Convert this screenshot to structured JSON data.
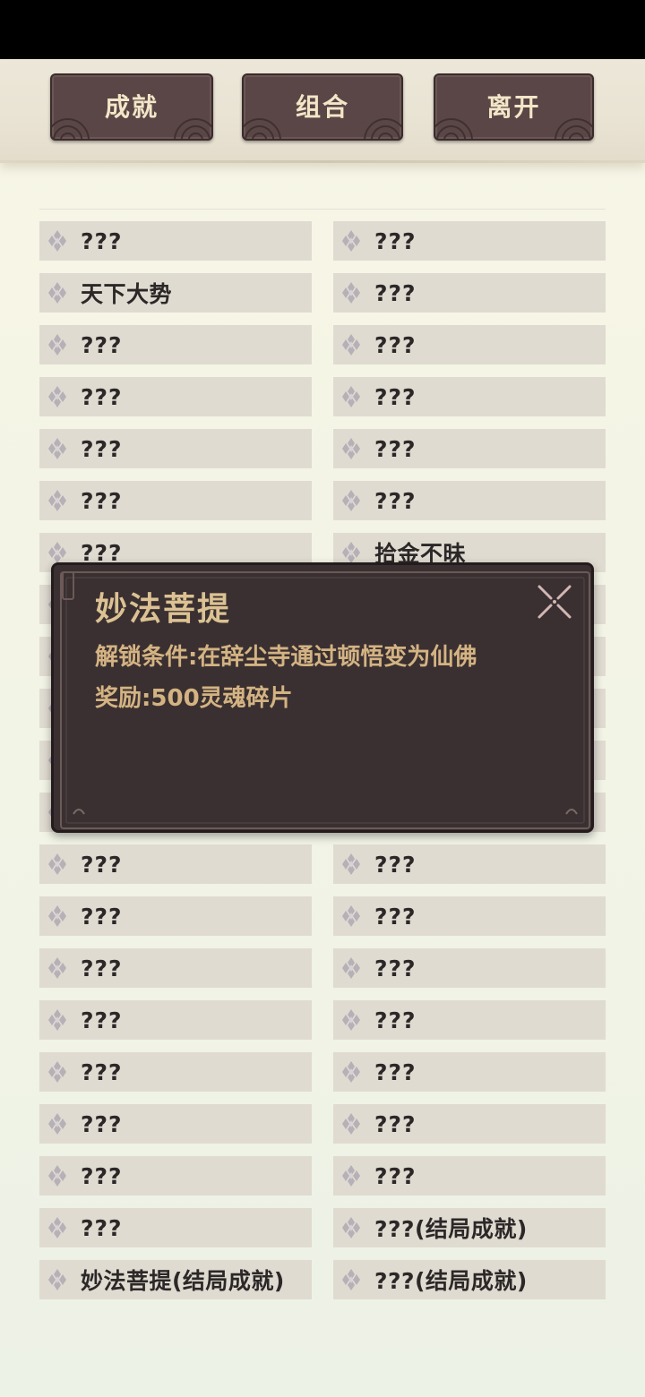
{
  "tabs": {
    "achievement": "成就",
    "combo": "组合",
    "leave": "离开"
  },
  "list": {
    "left": [
      "???",
      "天下大势",
      "???",
      "???",
      "???",
      "???",
      "???",
      "???",
      "???",
      "???",
      "???",
      "???",
      "???",
      "???",
      "???",
      "???",
      "???",
      "???",
      "???",
      "???",
      "妙法菩提(结局成就)"
    ],
    "right": [
      "???",
      "???",
      "???",
      "???",
      "???",
      "???",
      "拾金不昧",
      "???",
      "???",
      "???",
      "???",
      "???",
      "???",
      "???",
      "???",
      "???",
      "???",
      "???",
      "???",
      "???(结局成就)",
      "???(结局成就)"
    ]
  },
  "popup": {
    "title": "妙法菩提",
    "condition": "解锁条件:在辞尘寺通过顿悟变为仙佛",
    "reward": "奖励:500灵魂碎片"
  },
  "icons": {
    "row_marker": "diamond-cluster-icon",
    "close": "close-x-icon"
  },
  "colors": {
    "button_bg": "#5a4646",
    "button_text": "#f2e6c8",
    "cell_bg": "#e0dbd1",
    "popup_bg": "#3a3031",
    "popup_title": "#dcc293",
    "popup_text": "#d4b383"
  }
}
